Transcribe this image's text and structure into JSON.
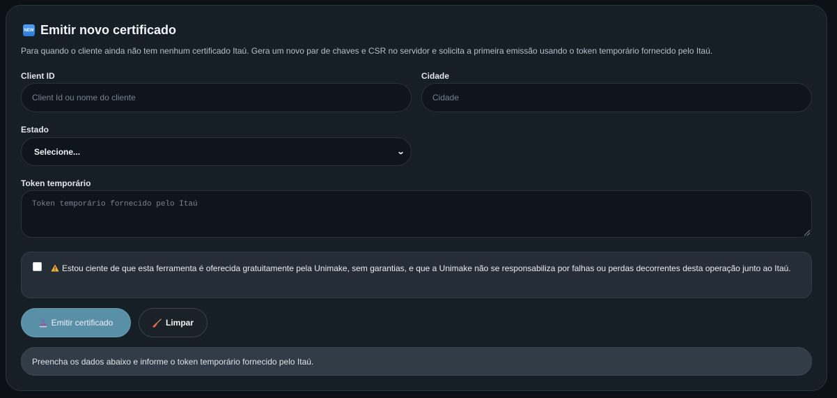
{
  "card": {
    "title": "Emitir novo certificado",
    "title_icon": "new-icon",
    "title_icon_text": "NEW",
    "subtitle": "Para quando o cliente ainda não tem nenhum certificado Itaú. Gera um novo par de chaves e CSR no servidor e solicita a primeira emissão usando o token temporário fornecido pelo Itaú."
  },
  "form": {
    "client_id": {
      "label": "Client ID",
      "value": "",
      "placeholder": "Client Id ou nome do cliente"
    },
    "cidade": {
      "label": "Cidade",
      "value": "",
      "placeholder": "Cidade"
    },
    "estado": {
      "label": "Estado",
      "selected": "Selecione..."
    },
    "token": {
      "label": "Token temporário",
      "value": "",
      "placeholder": "Token temporário fornecido pelo Itaú"
    }
  },
  "notice": {
    "checked": false,
    "icon": "warning-icon",
    "text": "Estou ciente de que esta ferramenta é oferecida gratuitamente pela Unimake, sem garantias, e que a Unimake não se responsabiliza por falhas ou perdas decorrentes desta operação junto ao Itaú."
  },
  "actions": {
    "emit_label": "Emitir certificado",
    "emit_icon": "stamp-icon",
    "clear_label": "Limpar",
    "clear_icon": "broom-icon"
  },
  "status": {
    "message": "Preencha os dados abaixo e informe o token temporário fornecido pelo Itaú."
  },
  "colors": {
    "background": "#0b1117",
    "card": "#161e26",
    "primary_button": "#5a8fa8",
    "status_bar": "#323c46"
  }
}
